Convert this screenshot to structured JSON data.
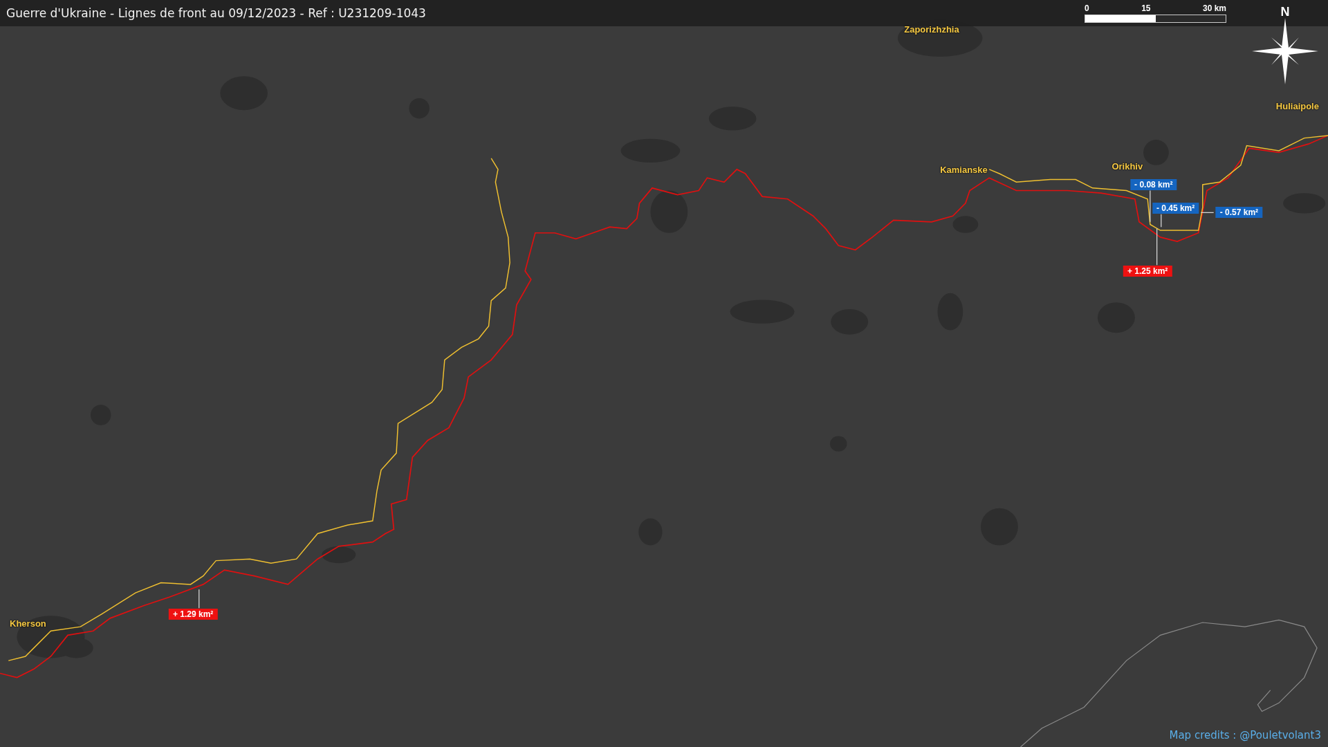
{
  "title": "Guerre d'Ukraine - Lignes de front au 09/12/2023 - Ref : U231209-1043",
  "scale_bar": {
    "ticks": [
      "0",
      "15",
      "30 km"
    ]
  },
  "compass": {
    "label": "N"
  },
  "cities": [
    {
      "name": "Zaporizhzhia"
    },
    {
      "name": "Huliaipole"
    },
    {
      "name": "Kamianske"
    },
    {
      "name": "Orikhiv"
    },
    {
      "name": "Kherson"
    }
  ],
  "badges": [
    {
      "text": "- 0.08 km²",
      "color": "#1565c0"
    },
    {
      "text": "- 0.45 km²",
      "color": "#1565c0"
    },
    {
      "text": "- 0.57 km²",
      "color": "#1565c0"
    },
    {
      "text": "+ 1.25 km²",
      "color": "#ee1111"
    },
    {
      "text": "+ 1.29 km²",
      "color": "#ee1111"
    }
  ],
  "credits": "Map credits : @Pouletvolant3"
}
